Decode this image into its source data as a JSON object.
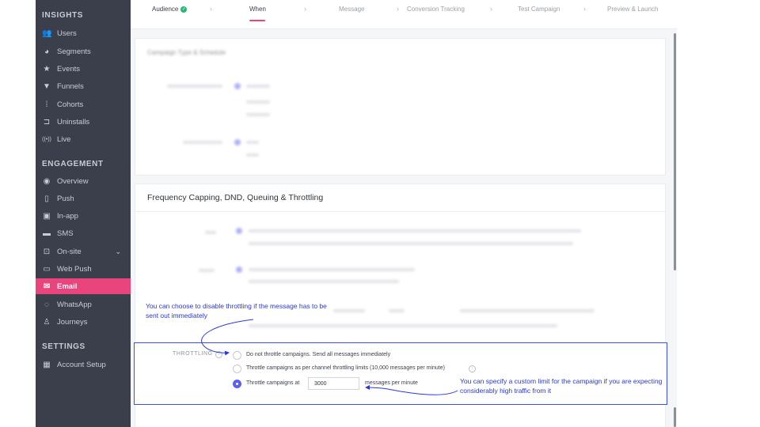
{
  "sidebar": {
    "sections": {
      "insights": "INSIGHTS",
      "engagement": "ENGAGEMENT",
      "settings": "SETTINGS"
    },
    "items": [
      {
        "label": "Users",
        "icon": "users-icon",
        "glyph": "👥"
      },
      {
        "label": "Segments",
        "icon": "pie-chart-icon",
        "glyph": "◕"
      },
      {
        "label": "Events",
        "icon": "star-icon",
        "glyph": "★"
      },
      {
        "label": "Funnels",
        "icon": "funnel-icon",
        "glyph": "▼"
      },
      {
        "label": "Cohorts",
        "icon": "cohorts-icon",
        "glyph": "⁞"
      },
      {
        "label": "Uninstalls",
        "icon": "uninstall-icon",
        "glyph": "⊐"
      },
      {
        "label": "Live",
        "icon": "live-icon",
        "glyph": "((•))"
      },
      {
        "label": "Overview",
        "icon": "eye-icon",
        "glyph": "◉"
      },
      {
        "label": "Push",
        "icon": "push-icon",
        "glyph": "▯"
      },
      {
        "label": "In-app",
        "icon": "in-app-icon",
        "glyph": "▣"
      },
      {
        "label": "SMS",
        "icon": "sms-icon",
        "glyph": "▬"
      },
      {
        "label": "On-site",
        "icon": "on-site-icon",
        "glyph": "⊡"
      },
      {
        "label": "Web Push",
        "icon": "web-push-icon",
        "glyph": "▭"
      },
      {
        "label": "Email",
        "icon": "email-icon",
        "glyph": "✉"
      },
      {
        "label": "WhatsApp",
        "icon": "whatsapp-icon",
        "glyph": "◌"
      },
      {
        "label": "Journeys",
        "icon": "journeys-icon",
        "glyph": "♙"
      },
      {
        "label": "Account Setup",
        "icon": "account-setup-icon",
        "glyph": "▦"
      }
    ],
    "active": "Email",
    "accent": "#e9447c"
  },
  "steps": [
    {
      "label": "Audience",
      "state": "done"
    },
    {
      "label": "When",
      "state": "current"
    },
    {
      "label": "Message",
      "state": "pending"
    },
    {
      "label": "Conversion Tracking",
      "state": "pending"
    },
    {
      "label": "Test Campaign",
      "state": "pending"
    },
    {
      "label": "Preview & Launch",
      "state": "pending"
    }
  ],
  "cards": {
    "campaign_type": "Campaign Type & Schedule",
    "frequency": "Frequency Capping, DND, Queuing & Throttling"
  },
  "throttling": {
    "label": "THROTTLING",
    "options": [
      "Do not throttle campaigns. Send all messages immediately",
      "Throttle campaigns as per channel throttling limits (10,000 messages per minute)",
      "Throttle campaigns at"
    ],
    "selected_index": 2,
    "rate_value": "3000",
    "rate_unit": "messages per minute"
  },
  "annotations": {
    "disable_note": "You can choose to disable throttling if the message has to be sent out immediately",
    "custom_note": "You can specify a custom limit for the campaign if you are expecting considerably high traffic from it",
    "color": "#2a38d6"
  }
}
